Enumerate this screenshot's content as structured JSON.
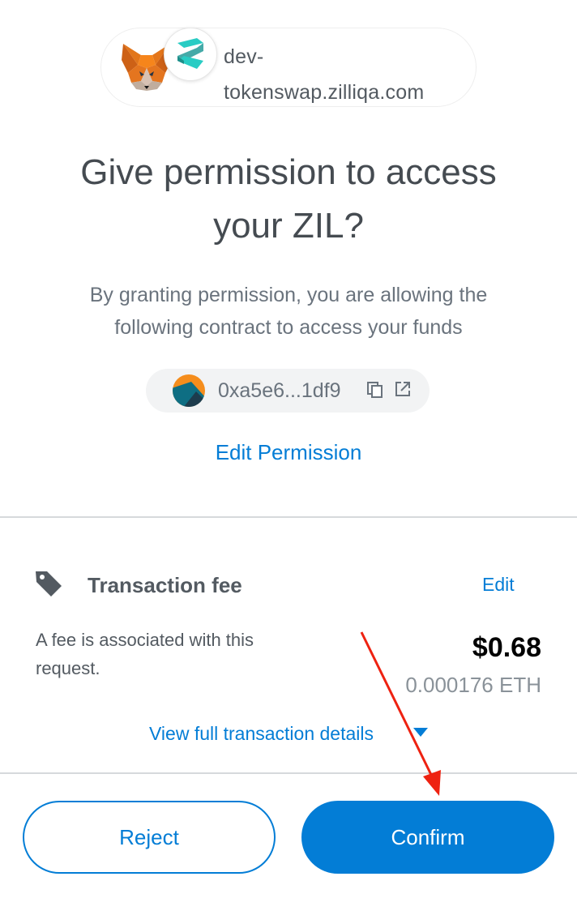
{
  "origin": {
    "line1": "dev-",
    "line2": "tokenswap.zilliqa.com",
    "wallet_icon": "metamask-fox-icon",
    "site_icon": "zilliqa-logo-icon"
  },
  "title": {
    "line1": "Give permission to access",
    "line2": "your ZIL?"
  },
  "subtitle": {
    "line1": "By granting permission, you are allowing the",
    "line2": "following contract to access your funds"
  },
  "contract": {
    "address": "0xa5e6...1df9",
    "copy_icon": "copy-icon",
    "external_icon": "external-link-icon"
  },
  "edit_permission": "Edit Permission",
  "fee": {
    "title": "Transaction fee",
    "edit": "Edit",
    "description": "A fee is associated with this request.",
    "usd": "$0.68",
    "eth": "0.000176 ETH",
    "view_details": "View full transaction details"
  },
  "buttons": {
    "reject": "Reject",
    "confirm": "Confirm"
  },
  "colors": {
    "accent": "#037dd6",
    "annotation": "#ee2211"
  }
}
